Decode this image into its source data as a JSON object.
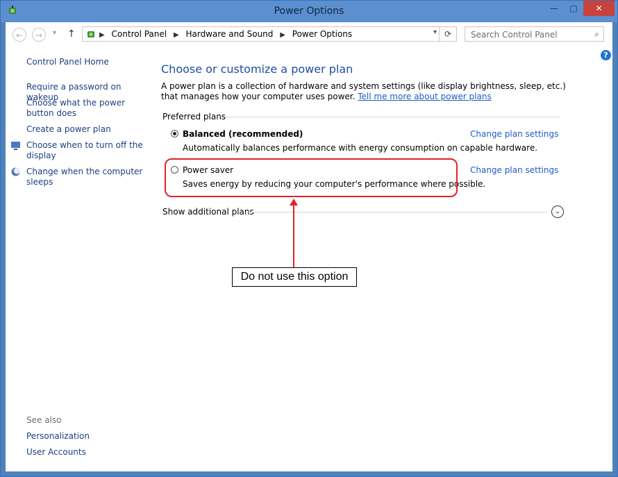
{
  "window": {
    "title": "Power Options",
    "min": "—",
    "max": "▢",
    "close": "✕"
  },
  "nav": {
    "back": "←",
    "forward": "→",
    "recent": "▾",
    "up": "↑",
    "breadcrumbs": [
      "Control Panel",
      "Hardware and Sound",
      "Power Options"
    ],
    "address_dropdown": "▾",
    "refresh": "⟳",
    "search_placeholder": "Search Control Panel",
    "search_icon": "⌕",
    "help": "?"
  },
  "sidebar": {
    "home": "Control Panel Home",
    "items": [
      "Require a password on wakeup",
      "Choose what the power button does",
      "Create a power plan",
      "Choose when to turn off the display",
      "Change when the computer sleeps"
    ],
    "see_also_heading": "See also",
    "see_also": [
      "Personalization",
      "User Accounts"
    ]
  },
  "main": {
    "heading": "Choose or customize a power plan",
    "description": "A power plan is a collection of hardware and system settings (like display brightness, sleep, etc.) that manages how your computer uses power.",
    "learn_more": "Tell me more about power plans",
    "preferred_label": "Preferred plans",
    "plans": [
      {
        "name": "Balanced (recommended)",
        "description": "Automatically balances performance with energy consumption on capable hardware.",
        "action": "Change plan settings",
        "selected": true
      },
      {
        "name": "Power saver",
        "description": "Saves energy by reducing your computer's performance where possible.",
        "action": "Change plan settings",
        "selected": false
      }
    ],
    "show_additional": "Show additional plans",
    "expand_icon": "⌄"
  },
  "annotation": {
    "note": "Do not use this option",
    "color": "#e3202a"
  }
}
